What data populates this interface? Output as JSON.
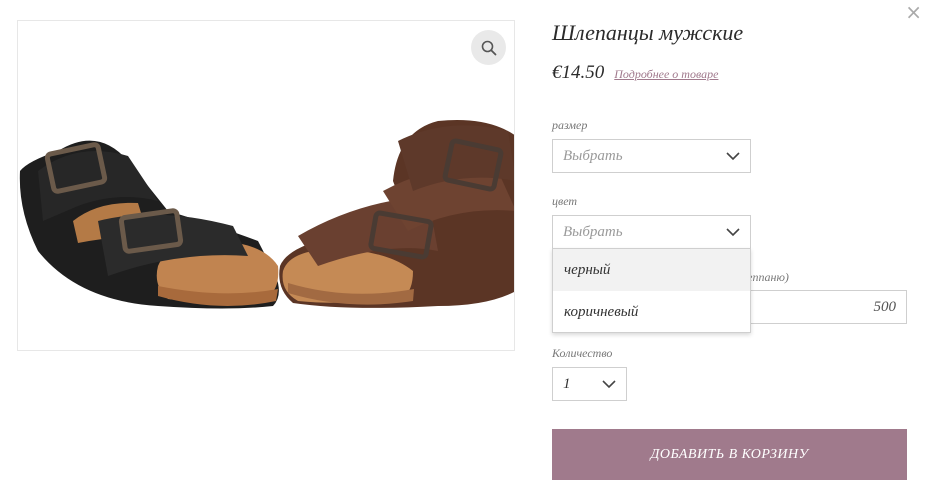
{
  "close_label": "×",
  "product": {
    "title": "Шлепанцы мужские",
    "price": "€14.50",
    "details_link": "Подробнее о товаре"
  },
  "options": {
    "size": {
      "label": "размер",
      "value": "Выбрать"
    },
    "color": {
      "label": "цвет",
      "value": "Выбрать",
      "dropdown_items": [
        "черный",
        "коричневый"
      ]
    },
    "hidden_field": {
      "label_fragment": "сеппаню)",
      "value": "500"
    },
    "quantity": {
      "label": "Количество",
      "value": "1"
    }
  },
  "cta": {
    "label": "ДОБАВИТЬ В КОРЗИНУ"
  },
  "colors": {
    "accent": "#a07a8c",
    "link": "#a0798c"
  },
  "icons": [
    "close-icon",
    "zoom-icon",
    "chevron-down-icon"
  ]
}
